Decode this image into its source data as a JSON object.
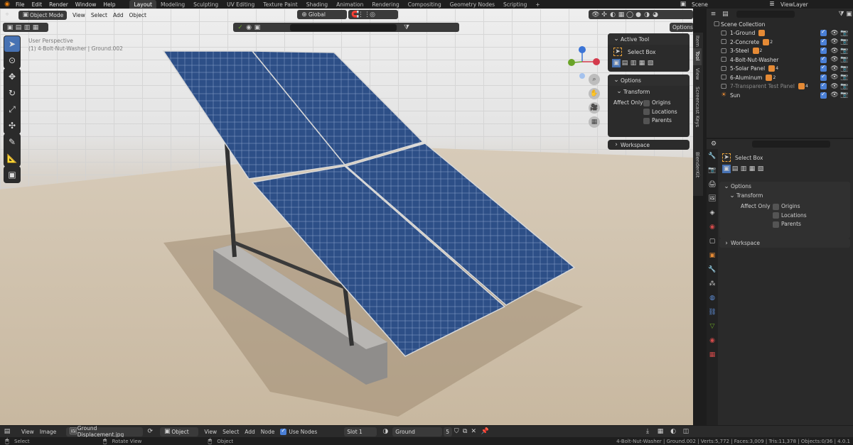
{
  "topbar": {
    "menu": [
      "File",
      "Edit",
      "Render",
      "Window",
      "Help"
    ],
    "workspaces": [
      "Layout",
      "Modeling",
      "Sculpting",
      "UV Editing",
      "Texture Paint",
      "Shading",
      "Animation",
      "Rendering",
      "Compositing",
      "Geometry Nodes",
      "Scripting"
    ],
    "active_workspace": "Layout",
    "add_workspace": "+",
    "scene_label": "Scene",
    "view_layer_label": "ViewLayer"
  },
  "viewport_header": {
    "mode": "Object Mode",
    "menu": [
      "View",
      "Select",
      "Add",
      "Object"
    ],
    "orientation": "Global",
    "options_label": "Options"
  },
  "viewport": {
    "perspective_label": "User Perspective",
    "object_info": "(1) 4-Bolt-Nut-Washer | Ground.002",
    "side_tabs": [
      "Item",
      "Tool",
      "View",
      "Screencast Keys",
      "BlenderKit"
    ]
  },
  "n_panel": {
    "active_tool_header": "Active Tool",
    "tool_name": "Select Box",
    "options_header": "Options",
    "transform_header": "Transform",
    "affect_only_label": "Affect Only",
    "checks": [
      "Origins",
      "Locations",
      "Parents"
    ],
    "workspace_header": "Workspace"
  },
  "outliner": {
    "root": "Scene Collection",
    "items": [
      {
        "label": "1-Ground",
        "sub": ""
      },
      {
        "label": "2-Concrete",
        "sub": "2"
      },
      {
        "label": "3-Steel",
        "sub": "2"
      },
      {
        "label": "4-Bolt-Nut-Washer",
        "sub": ""
      },
      {
        "label": "5-Solar Panel",
        "sub": "4"
      },
      {
        "label": "6-Aluminum",
        "sub": "2"
      },
      {
        "label": "7-Transparent Test Panel",
        "sub": "4"
      },
      {
        "label": "Sun",
        "sub": ""
      }
    ]
  },
  "properties": {
    "tool_name": "Select Box",
    "options_header": "Options",
    "transform_header": "Transform",
    "affect_only_label": "Affect Only",
    "checks": [
      "Origins",
      "Locations",
      "Parents"
    ],
    "workspace_header": "Workspace"
  },
  "bottom_bar": {
    "menu_left": [
      "View",
      "Image"
    ],
    "image_name": "Ground Displacement.jpg",
    "object_selector": "Object",
    "menu_mid": [
      "View",
      "Select",
      "Add",
      "Node"
    ],
    "use_nodes_label": "Use Nodes",
    "slot": "Slot 1",
    "material": "Ground",
    "users_count": "5"
  },
  "status_bar": {
    "select": "Select",
    "rotate": "Rotate View",
    "object": "Object",
    "stats": "4-Bolt-Nut-Washer | Ground.002 | Verts:5,772 | Faces:3,009 | Tris:11,378 | Objects:0/36 | 4.0.1"
  },
  "colors": {
    "accent": "#4772b3",
    "panel_bg": "#2b2b2b",
    "solar_blue": "#2c4f86",
    "ground": "#cbbda9"
  }
}
